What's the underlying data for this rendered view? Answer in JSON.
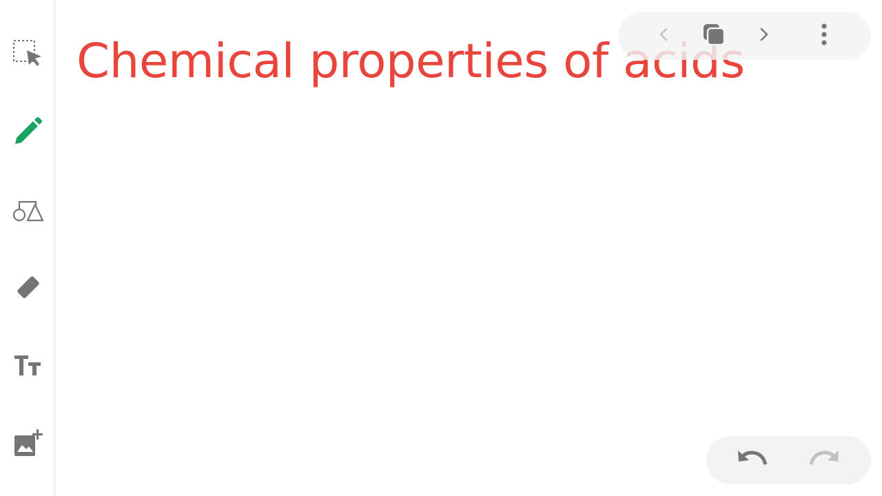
{
  "canvas": {
    "title_text": "Chemical properties of acids",
    "title_color": "#e8453c"
  },
  "toolbar": {
    "tools": [
      {
        "name": "select-tool",
        "icon": "marquee-select-icon",
        "active": false
      },
      {
        "name": "pen-tool",
        "icon": "pencil-icon",
        "active": true,
        "color": "#1aa260"
      },
      {
        "name": "shapes-tool",
        "icon": "shapes-icon",
        "active": false
      },
      {
        "name": "eraser-tool",
        "icon": "eraser-icon",
        "active": false
      },
      {
        "name": "text-tool",
        "icon": "text-size-icon",
        "active": false
      },
      {
        "name": "add-image-tool",
        "icon": "add-image-icon",
        "active": false
      }
    ],
    "icon_color": "#757575"
  },
  "frame_nav": {
    "prev_icon": "chevron-left-icon",
    "prev_enabled": false,
    "frames_icon": "frames-icon",
    "next_icon": "chevron-right-icon",
    "next_enabled": true,
    "more_icon": "more-vert-icon"
  },
  "history": {
    "undo_icon": "undo-icon",
    "undo_enabled": true,
    "redo_icon": "redo-icon",
    "redo_enabled": false
  },
  "colors": {
    "accent_green": "#1aa260",
    "icon_gray": "#757575",
    "disabled_gray": "#c2c2c2",
    "pill_bg": "#f2f3f3",
    "divider": "#cfe0e8"
  }
}
